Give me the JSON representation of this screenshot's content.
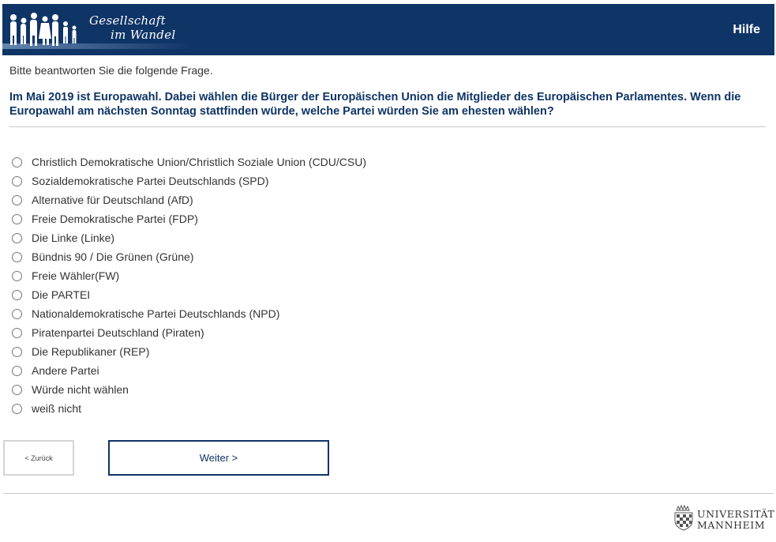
{
  "header": {
    "logo_line1": "Gesellschaft",
    "logo_line2": "im Wandel",
    "help_label": "Hilfe",
    "background_color": "#0f3466"
  },
  "survey": {
    "instruction": "Bitte beantworten Sie die folgende Frage.",
    "question": "Im Mai 2019 ist Europawahl. Dabei wählen die Bürger der Europäischen Union die Mitglieder des Europäischen Parlamentes. Wenn die Europawahl am nächsten Sonntag stattfinden würde, welche Partei würden Sie am ehesten wählen?",
    "options": [
      "Christlich Demokratische Union/Christlich Soziale Union (CDU/CSU)",
      "Sozialdemokratische Partei Deutschlands (SPD)",
      "Alternative für Deutschland (AfD)",
      "Freie Demokratische Partei (FDP)",
      "Die Linke (Linke)",
      "Bündnis 90 / Die Grünen (Grüne)",
      "Freie Wähler(FW)",
      "Die PARTEI",
      "Nationaldemokratische Partei Deutschlands (NPD)",
      "Piratenpartei Deutschland (Piraten)",
      "Die Republikaner (REP)",
      "Andere Partei",
      "Würde nicht wählen",
      "weiß nicht"
    ]
  },
  "navigation": {
    "back_label": "< Zurück",
    "next_label": "Weiter >"
  },
  "footer": {
    "university_line1": "UNIVERSITÄT",
    "university_line2": "MANNHEIM"
  },
  "icons": {
    "logo": "people-silhouettes-icon",
    "university": "university-crest-icon"
  }
}
